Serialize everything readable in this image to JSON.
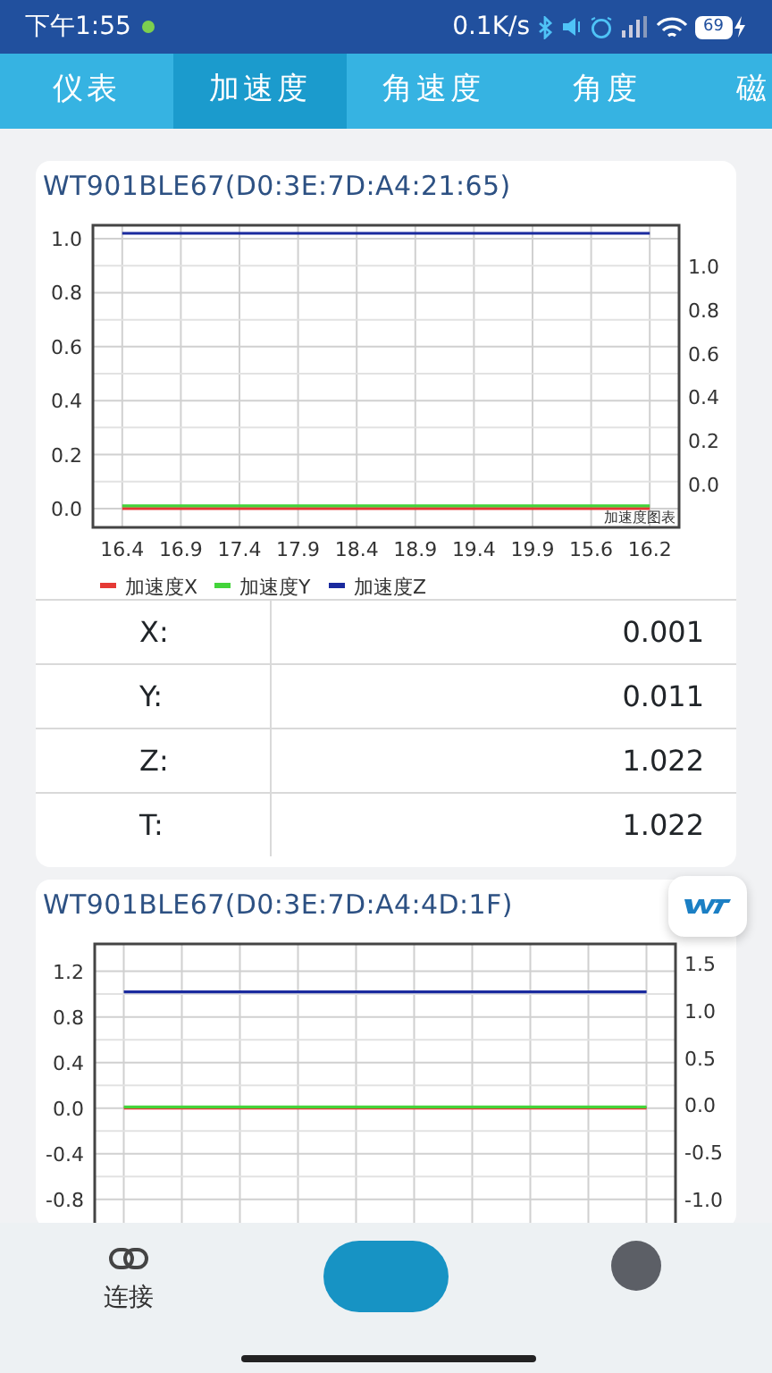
{
  "status_bar": {
    "time": "下午1:55",
    "speed": "0.1K/s",
    "battery": "69"
  },
  "tabs": [
    {
      "label": "仪表",
      "selected": false
    },
    {
      "label": "加速度",
      "selected": true
    },
    {
      "label": "角速度",
      "selected": false
    },
    {
      "label": "角度",
      "selected": false
    },
    {
      "label": "磁",
      "selected": false
    }
  ],
  "devices": [
    {
      "title": "WT901BLE67(D0:3E:7D:A4:21:65)",
      "right_axis_ticks": [
        "1.0",
        "0.8",
        "0.6",
        "0.4",
        "0.2",
        "0.0"
      ],
      "chart_data": {
        "type": "line",
        "title": "加速度图表",
        "grid": true,
        "legend": true,
        "categories": [
          "16.4",
          "16.9",
          "17.4",
          "17.9",
          "18.4",
          "18.9",
          "19.4",
          "19.9",
          "15.6",
          "16.2"
        ],
        "ylim": [
          -0.07,
          1.05
        ],
        "yticks": [
          {
            "value": 0,
            "label": "0.0"
          },
          {
            "value": 0.2,
            "label": "0.2"
          },
          {
            "value": 0.4,
            "label": "0.4"
          },
          {
            "value": 0.6,
            "label": "0.6"
          },
          {
            "value": 0.8,
            "label": "0.8"
          },
          {
            "value": 1,
            "label": "1.0"
          }
        ],
        "series": [
          {
            "name": "加速度X",
            "color": "#e53935",
            "values": [
              0.0,
              0.0,
              0.0,
              0.0,
              0.0,
              0.0,
              0.0,
              0.0,
              0.0,
              0.0
            ]
          },
          {
            "name": "加速度Y",
            "color": "#43d43a",
            "values": [
              0.01,
              0.01,
              0.01,
              0.01,
              0.01,
              0.01,
              0.01,
              0.01,
              0.01,
              0.01
            ]
          },
          {
            "name": "加速度Z",
            "color": "#1a2a9e",
            "values": [
              1.02,
              1.02,
              1.02,
              1.02,
              1.02,
              1.02,
              1.02,
              1.02,
              1.02,
              1.02
            ]
          }
        ]
      },
      "readings": [
        {
          "label": "X:",
          "value": "0.001"
        },
        {
          "label": "Y:",
          "value": "0.011"
        },
        {
          "label": "Z:",
          "value": "1.022"
        },
        {
          "label": "T:",
          "value": "1.022"
        }
      ]
    },
    {
      "title": "WT901BLE67(D0:3E:7D:A4:4D:1F)",
      "logo": true,
      "right_axis_ticks": [
        "1.5",
        "1.0",
        "0.5",
        "0.0",
        "-0.5",
        "-1.0"
      ],
      "chart_data": {
        "type": "line",
        "grid": true,
        "ylim": [
          -1.21,
          1.44
        ],
        "yticks": [
          {
            "value": -0.8,
            "label": "-0.8"
          },
          {
            "value": -0.4,
            "label": "-0.4"
          },
          {
            "value": 0,
            "label": "0.0"
          },
          {
            "value": 0.4,
            "label": "0.4"
          },
          {
            "value": 0.8,
            "label": "0.8"
          },
          {
            "value": 1.2,
            "label": "1.2"
          }
        ],
        "series": [
          {
            "color": "#e53935",
            "values": [
              0.0,
              0.0,
              0.0,
              0.0,
              0.0,
              0.0,
              0.0,
              0.0,
              0.0,
              0.0
            ]
          },
          {
            "color": "#43d43a",
            "values": [
              0.01,
              0.01,
              0.01,
              0.01,
              0.01,
              0.01,
              0.01,
              0.01,
              0.01,
              0.01
            ]
          },
          {
            "color": "#1a2a9e",
            "values": [
              1.02,
              1.02,
              1.02,
              1.02,
              1.02,
              1.02,
              1.02,
              1.02,
              1.02,
              1.02
            ]
          }
        ]
      }
    }
  ],
  "bottom_nav": [
    {
      "label": "连接",
      "kind": "link"
    },
    {
      "kind": "center"
    },
    {
      "kind": "round"
    }
  ]
}
